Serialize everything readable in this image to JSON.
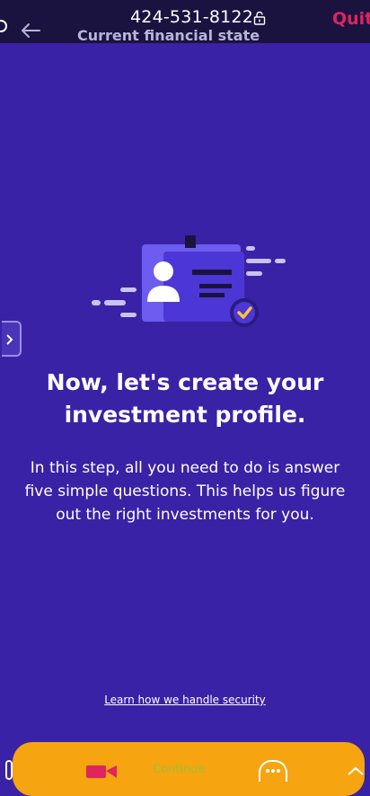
{
  "header": {
    "phone_number": "424-531-8122",
    "subtitle": "Current financial state",
    "quit_label": "Quit"
  },
  "content": {
    "headline": "Now, let's create your investment profile.",
    "body": "In this step, all you need to do is answer five simple questions. This helps us figure out the right investments for you.",
    "security_link": "Learn how we handle security"
  },
  "footer": {
    "continue_label": "Continue"
  },
  "colors": {
    "background": "#3a22a6",
    "topbar": "#1a1340",
    "quit": "#e0245e",
    "continue_bar": "#f6a410",
    "continue_text": "#9bc13a",
    "check_badge": "#f6c23e"
  },
  "icons": [
    "back-arrow-icon",
    "lock-icon",
    "id-card-icon",
    "checkmark-badge-icon",
    "chevron-right-icon",
    "video-icon",
    "more-icon"
  ]
}
